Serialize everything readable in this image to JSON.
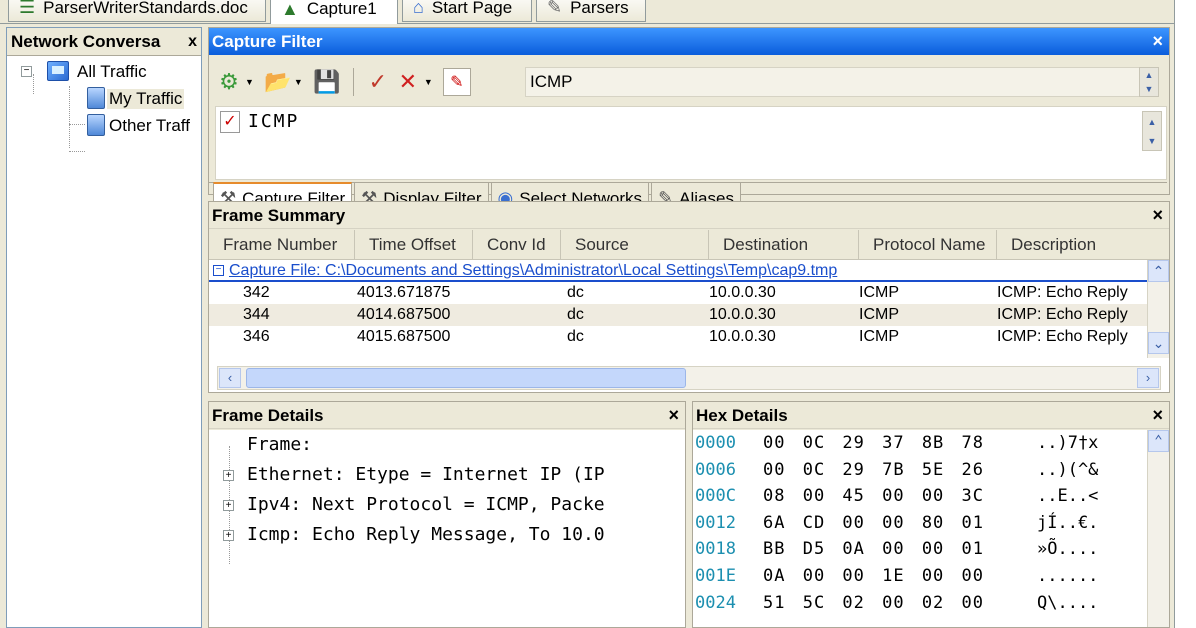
{
  "doc_tabs": [
    {
      "label": "ParserWriterStandards.doc",
      "icon": "document-icon"
    },
    {
      "label": "Capture1",
      "icon": "capture-icon"
    },
    {
      "label": "Start Page",
      "icon": "home-icon"
    },
    {
      "label": "Parsers",
      "icon": "parser-icon"
    }
  ],
  "conversations": {
    "title": "Network Conversa",
    "close": "x",
    "tree": {
      "root": "All Traffic",
      "children": [
        "My Traffic",
        "Other Traff"
      ]
    }
  },
  "capture_filter": {
    "title": "Capture Filter",
    "close": "×",
    "toolbar_combo_value": "ICMP",
    "filter_text": "ICMP",
    "tabs": [
      "Capture Filter",
      "Display Filter",
      "Select Networks",
      "Aliases"
    ]
  },
  "frame_summary": {
    "title": "Frame Summary",
    "close": "×",
    "columns": [
      "Frame Number",
      "Time Offset",
      "Conv Id",
      "Source",
      "Destination",
      "Protocol Name",
      "Description"
    ],
    "group_label": "Capture File: C:\\Documents and Settings\\Administrator\\Local Settings\\Temp\\cap9.tmp",
    "rows": [
      {
        "frame": "342",
        "time": "4013.671875",
        "conv": "",
        "source": "dc",
        "dest": "10.0.0.30",
        "proto": "ICMP",
        "desc": "ICMP: Echo Reply"
      },
      {
        "frame": "344",
        "time": "4014.687500",
        "conv": "",
        "source": "dc",
        "dest": "10.0.0.30",
        "proto": "ICMP",
        "desc": "ICMP: Echo Reply"
      },
      {
        "frame": "346",
        "time": "4015.687500",
        "conv": "",
        "source": "dc",
        "dest": "10.0.0.30",
        "proto": "ICMP",
        "desc": "ICMP: Echo Reply"
      }
    ]
  },
  "frame_details": {
    "title": "Frame Details",
    "close": "×",
    "lines": [
      "Frame:",
      "Ethernet: Etype = Internet IP (IP",
      "Ipv4: Next Protocol = ICMP, Packe",
      "Icmp: Echo Reply Message, To 10.0"
    ]
  },
  "hex_details": {
    "title": "Hex Details",
    "close": "×",
    "rows": [
      {
        "offset": "0000",
        "bytes": "00 0C 29 37 8B 78",
        "ascii": "..)7†x"
      },
      {
        "offset": "0006",
        "bytes": "00 0C 29 7B 5E 26",
        "ascii": "..)(^&"
      },
      {
        "offset": "000C",
        "bytes": "08 00 45 00 00 3C",
        "ascii": "..E..<"
      },
      {
        "offset": "0012",
        "bytes": "6A CD 00 00 80 01",
        "ascii": "jÍ..€."
      },
      {
        "offset": "0018",
        "bytes": "BB D5 0A 00 00 01",
        "ascii": "»Õ...."
      },
      {
        "offset": "001E",
        "bytes": "0A 00 00 1E 00 00",
        "ascii": "......"
      },
      {
        "offset": "0024",
        "bytes": "51 5C 02 00 02 00",
        "ascii": "Q\\...."
      }
    ]
  }
}
